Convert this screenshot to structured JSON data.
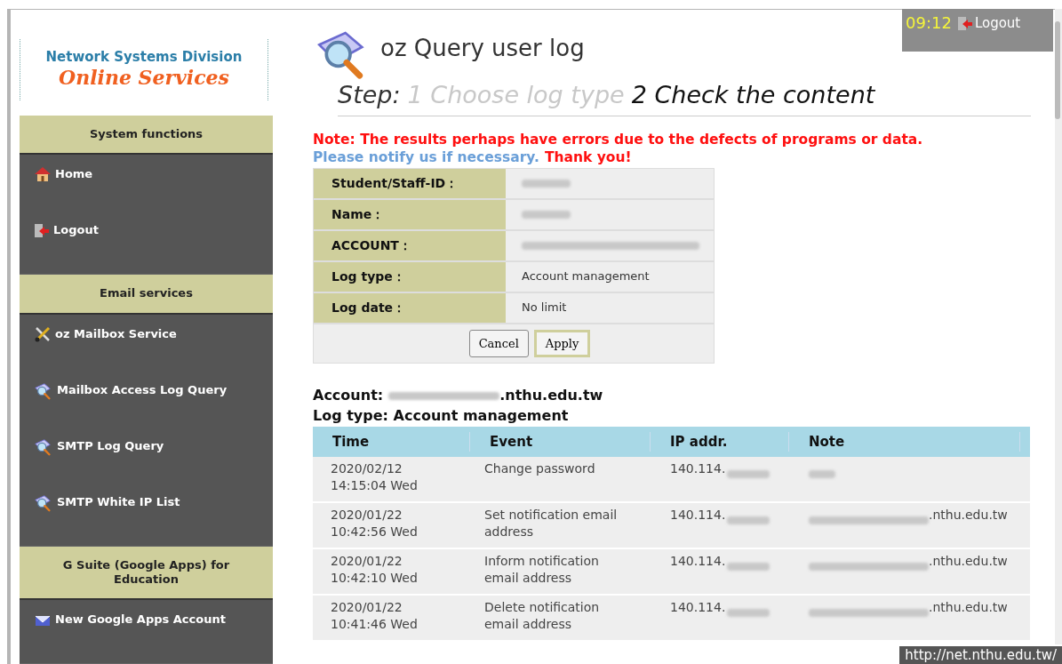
{
  "header": {
    "time": "09:12",
    "logout": "Logout"
  },
  "logo": {
    "line1": "Network Systems Division",
    "line2": "Online Services"
  },
  "sidebar": {
    "sections": [
      {
        "title": "System functions",
        "items": [
          {
            "label": "Home",
            "kind": "home"
          },
          {
            "label": "Logout",
            "kind": "logout"
          }
        ]
      },
      {
        "title": "Email services",
        "items": [
          {
            "label": "oz Mailbox Service",
            "kind": "tools"
          },
          {
            "label": "Mailbox Access Log Query",
            "kind": "search"
          },
          {
            "label": "SMTP Log Query",
            "kind": "search"
          },
          {
            "label": "SMTP White IP List",
            "kind": "search"
          }
        ]
      },
      {
        "title": "G Suite (Google Apps) for Education",
        "items": [
          {
            "label": "New Google Apps Account",
            "kind": "mail"
          }
        ]
      }
    ]
  },
  "page": {
    "title": "oz Query user log",
    "step_label": "Step:",
    "steps": [
      {
        "label": "1 Choose log type",
        "selected": false
      },
      {
        "label": "2 Check the content",
        "selected": true
      }
    ]
  },
  "notice": {
    "warning": "Note: The results perhaps have errors due to the defects of programs or data.",
    "info": "Please notify us if necessary.",
    "thanks": "Thank you!"
  },
  "summary": {
    "fields": [
      {
        "label": "Student/Staff-ID：",
        "redacted": true
      },
      {
        "label": "Name：",
        "redacted": true
      },
      {
        "label": "ACCOUNT：",
        "redacted": true
      },
      {
        "label": "Log type：",
        "value": "Account management",
        "redacted": false
      },
      {
        "label": "Log date：",
        "value": "No limit",
        "redacted": false
      }
    ],
    "buttons": [
      {
        "label": "Cancel",
        "focused": false
      },
      {
        "label": "Apply",
        "focused": true
      }
    ]
  },
  "result": {
    "account_label": "Account:",
    "account_suffix": ".nthu.edu.tw",
    "log_type": "Log type: Account management"
  },
  "table": {
    "columns": [
      "Time",
      "Event",
      "IP addr.",
      "Note"
    ],
    "rows": [
      {
        "date": "2020/02/12",
        "clock": "14:15:04 Wed",
        "event": "Change password",
        "ip": "140.114."
      },
      {
        "date": "2020/01/22",
        "clock": "10:42:56 Wed",
        "event": "Set notification email address",
        "ip": "140.114.",
        "note": ".nthu.edu.tw"
      },
      {
        "date": "2020/01/22",
        "clock": "10:42:10 Wed",
        "event": "Inform notification email address",
        "ip": "140.114.",
        "note": ".nthu.edu.tw"
      },
      {
        "date": "2020/01/22",
        "clock": "10:41:46 Wed",
        "event": "Delete notification email address",
        "ip": "140.114.",
        "note": ".nthu.edu.tw"
      }
    ]
  },
  "status_url": "http://net.nthu.edu.tw/"
}
